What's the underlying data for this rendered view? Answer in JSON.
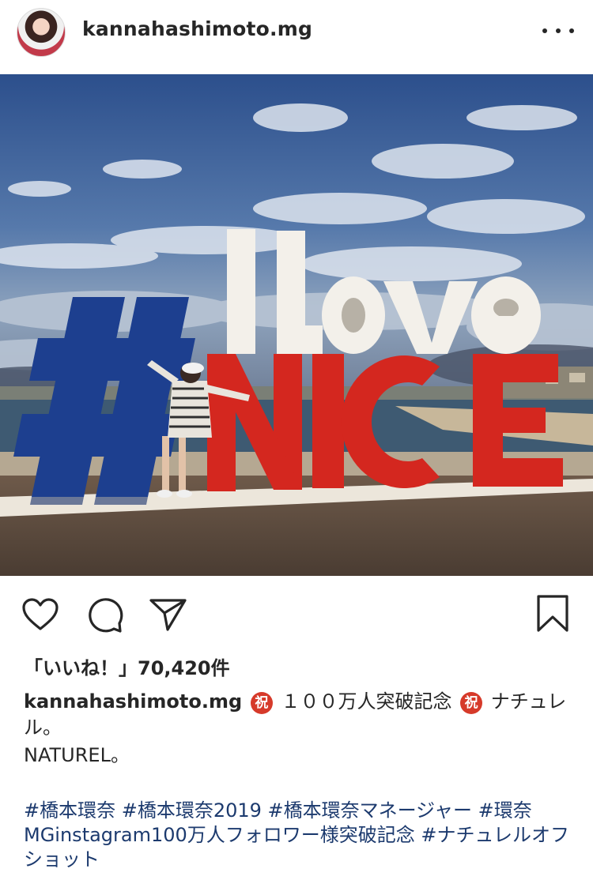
{
  "post": {
    "username": "kannahashimoto.mg",
    "likes_text": "「いいね！」70,420件"
  },
  "caption": {
    "username": "kannahashimoto.mg",
    "emoji_celebrate": "祝",
    "text_part1": "１００万人突破記念",
    "text_part2": "ナチュレル。",
    "line2": "NATUREL。",
    "hashtags": "#橋本環奈 #橋本環奈2019 #橋本環奈マネージャー #環奈MGinstagram100万人フォロワー様突破記念 #ナチュレルオフショット"
  },
  "icons": [
    "more-icon",
    "heart-icon",
    "comment-icon",
    "share-icon",
    "bookmark-icon"
  ],
  "colors": {
    "text": "#262626",
    "hashtag": "#1c3a6e",
    "celebrate_badge": "#d63a2a",
    "sign_blue": "#1d3f8f",
    "sign_red": "#d4271f",
    "sign_white": "#f3f0ea"
  }
}
